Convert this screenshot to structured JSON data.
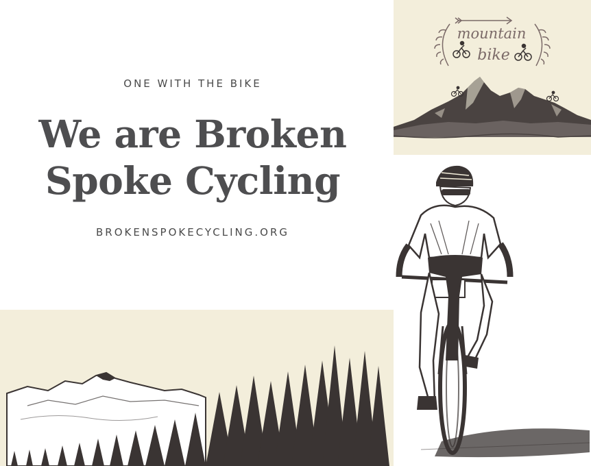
{
  "hero": {
    "tagline": "ONE WITH THE BIKE",
    "title_line1": "We are Broken",
    "title_line2": "Spoke Cycling",
    "url": "BROKENSPOKECYCLING.ORG"
  },
  "logo": {
    "word1": "mountain",
    "word2": "bike"
  },
  "colors": {
    "cream": "#f3eedb",
    "ink": "#4e4e50",
    "sketch": "#3a3433",
    "logo_text": "#7b6a68"
  }
}
